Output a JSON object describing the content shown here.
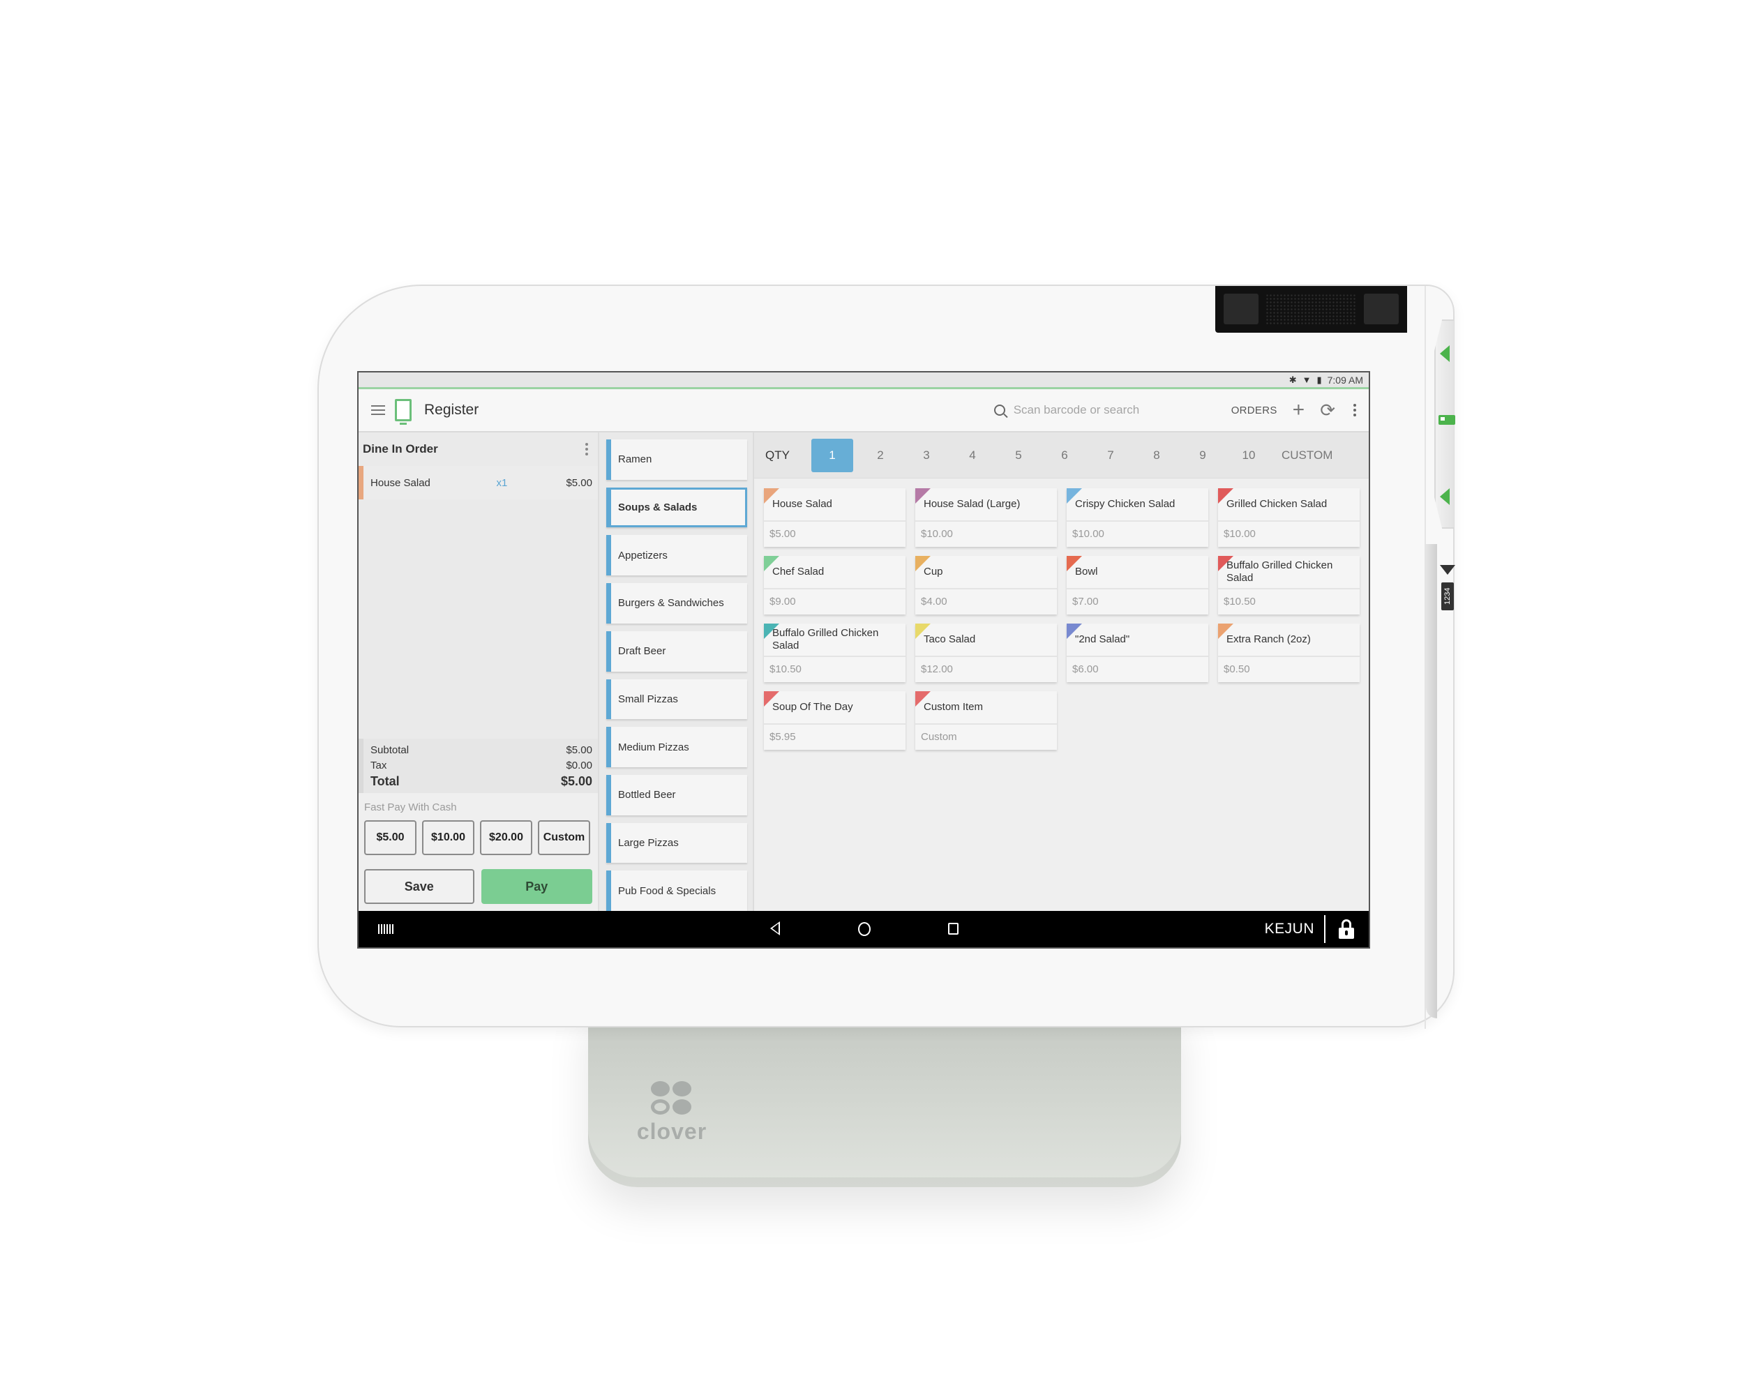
{
  "status_bar": {
    "time": "7:09 AM",
    "icons": [
      "bluetooth-icon",
      "wifi-icon",
      "battery-icon"
    ]
  },
  "app_bar": {
    "title": "Register",
    "search_placeholder": "Scan barcode or search",
    "orders_label": "ORDERS",
    "add_icon": "+",
    "refresh_icon": "⟳"
  },
  "order": {
    "title": "Dine In Order",
    "line_items": [
      {
        "name": "House Salad",
        "qty": "x1",
        "price": "$5.00"
      }
    ],
    "subtotal_label": "Subtotal",
    "subtotal": "$5.00",
    "tax_label": "Tax",
    "tax": "$0.00",
    "total_label": "Total",
    "total": "$5.00",
    "fast_pay_label": "Fast Pay With Cash",
    "fast_pay_options": [
      "$5.00",
      "$10.00",
      "$20.00",
      "Custom"
    ],
    "save_label": "Save",
    "pay_label": "Pay"
  },
  "categories": [
    {
      "label": "Ramen",
      "active": false
    },
    {
      "label": "Soups & Salads",
      "active": true
    },
    {
      "label": "Appetizers",
      "active": false
    },
    {
      "label": "Burgers & Sandwiches",
      "active": false
    },
    {
      "label": "Draft Beer",
      "active": false
    },
    {
      "label": "Small Pizzas",
      "active": false
    },
    {
      "label": "Medium Pizzas",
      "active": false
    },
    {
      "label": "Bottled Beer",
      "active": false
    },
    {
      "label": "Large Pizzas",
      "active": false
    },
    {
      "label": "Pub Food & Specials",
      "active": false
    }
  ],
  "qty_bar": {
    "label": "QTY",
    "options": [
      "1",
      "2",
      "3",
      "4",
      "5",
      "6",
      "7",
      "8",
      "9",
      "10"
    ],
    "selected": "1",
    "custom_label": "CUSTOM"
  },
  "items": [
    {
      "name": "House Salad",
      "price": "$5.00",
      "color": "#e9a57c"
    },
    {
      "name": "House Salad (Large)",
      "price": "$10.00",
      "color": "#b57aa6"
    },
    {
      "name": "Crispy Chicken Salad",
      "price": "$10.00",
      "color": "#76b4de"
    },
    {
      "name": "Grilled Chicken Salad",
      "price": "$10.00",
      "color": "#e05a5a"
    },
    {
      "name": "Chef Salad",
      "price": "$9.00",
      "color": "#7fcf97"
    },
    {
      "name": "Cup",
      "price": "$4.00",
      "color": "#e8b060"
    },
    {
      "name": "Bowl",
      "price": "$7.00",
      "color": "#e56a4f"
    },
    {
      "name": "Buffalo Grilled Chicken Salad",
      "price": "$10.50",
      "color": "#e05a5a"
    },
    {
      "name": "Buffalo Grilled Chicken Salad",
      "price": "$10.50",
      "color": "#4bb4b4"
    },
    {
      "name": "Taco Salad",
      "price": "$12.00",
      "color": "#e8d96a"
    },
    {
      "name": "\"2nd Salad\"",
      "price": "$6.00",
      "color": "#7889d0"
    },
    {
      "name": "Extra Ranch (2oz)",
      "price": "$0.50",
      "color": "#eba270"
    },
    {
      "name": "Soup Of The Day",
      "price": "$5.95",
      "color": "#e46b6b"
    },
    {
      "name": "Custom Item",
      "price": "Custom",
      "color": "#e46b6b"
    }
  ],
  "nav_bar": {
    "user": "KEJUN"
  },
  "hardware": {
    "brand": "clover",
    "pin_pad_label": "1234"
  }
}
